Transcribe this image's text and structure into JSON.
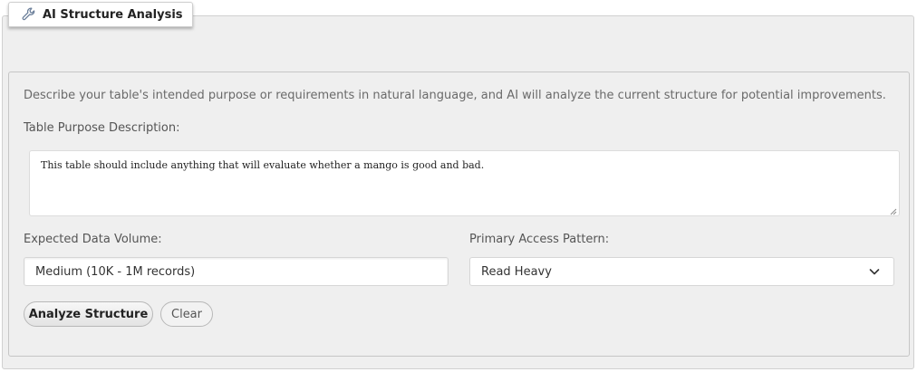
{
  "panel": {
    "tab_title": "AI Structure Analysis",
    "tab_icon": "wrench-icon"
  },
  "form": {
    "description": "Describe your table's intended purpose or requirements in natural language, and AI will analyze the current structure for potential improvements.",
    "purpose_label": "Table Purpose Description:",
    "purpose_value": "This table should include anything that will evaluate whether a mango is good and bad.",
    "volume_label": "Expected Data Volume:",
    "volume_value": "Medium (10K - 1M records)",
    "access_label": "Primary Access Pattern:",
    "access_value": "Read Heavy"
  },
  "buttons": {
    "analyze_label": "Analyze Structure",
    "clear_label": "Clear"
  },
  "colors": {
    "panel_background": "#efefef",
    "description_text": "#6a6a6a"
  }
}
